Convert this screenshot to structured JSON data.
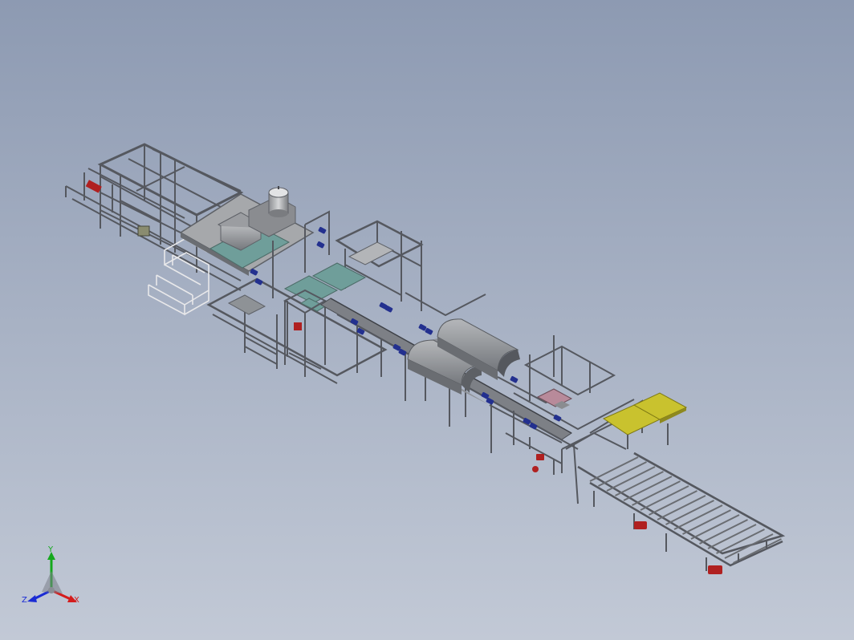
{
  "viewport": {
    "background_top": "#8d9ab2",
    "background_bottom": "#c2c9d6"
  },
  "model": {
    "frame_color": "#5b5e66",
    "panel_color": "#9a9c9f",
    "conveyor_panel_color": "#6f9e9a",
    "motor_color": "#23308f",
    "motor_accent_color": "#b02020",
    "platform_color": "#c9c22e"
  },
  "triad": {
    "x_label": "X",
    "y_label": "Y",
    "z_label": "Z",
    "x_color": "#d41c1c",
    "y_color": "#15a81d",
    "z_color": "#1a2bd4"
  }
}
